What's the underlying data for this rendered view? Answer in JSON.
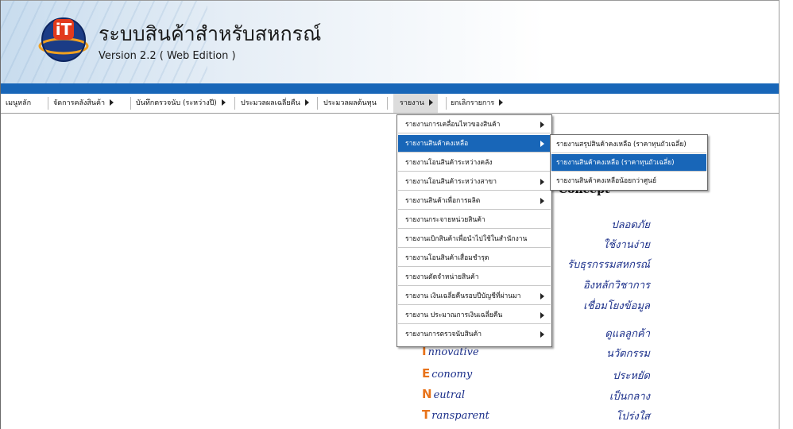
{
  "app": {
    "title": "ระบบสินค้าสำหรับสหกรณ์",
    "version": "Version 2.2 ( Web Edition )",
    "logo_text": "iT"
  },
  "colors": {
    "accent": "#1866b8",
    "highlight_text": "#ffffff",
    "value_text": "#1b2f8a",
    "initial_letter": "#e8731a"
  },
  "menubar": {
    "items": [
      {
        "label": "เมนูหลัก",
        "has_submenu": false
      },
      {
        "label": "จัดการคลังสินค้า",
        "has_submenu": true
      },
      {
        "label": "บันทึกตรวจนับ (ระหว่างปี)",
        "has_submenu": true
      },
      {
        "label": "ประมวลผลเฉลี่ยคืน",
        "has_submenu": true
      },
      {
        "label": "ประมวลผลต้นทุน",
        "has_submenu": false
      },
      {
        "label": "รายงาน",
        "has_submenu": true,
        "active": true
      },
      {
        "label": "ยกเลิกรายการ",
        "has_submenu": true
      }
    ]
  },
  "report_menu": {
    "items": [
      {
        "label": "รายงานการเคลื่อนไหวของสินค้า",
        "has_submenu": true
      },
      {
        "label": "รายงานสินค้าคงเหลือ",
        "has_submenu": true,
        "highlighted": true
      },
      {
        "label": "รายงานโอนสินค้าระหว่างคลัง",
        "has_submenu": false
      },
      {
        "label": "รายงานโอนสินค้าระหว่างสาขา",
        "has_submenu": true
      },
      {
        "label": "รายงานสินค้าเพื่อการผลิต",
        "has_submenu": true
      },
      {
        "label": "รายงานกระจายหน่วยสินค้า",
        "has_submenu": false
      },
      {
        "label": "รายงานเบิกสินค้าเพื่อนำไปใช้ในสำนักงาน",
        "has_submenu": false
      },
      {
        "label": "รายงานโอนสินค้าเสื่อมชำรุด",
        "has_submenu": false
      },
      {
        "label": "รายงานตัดจำหน่ายสินค้า",
        "has_submenu": false
      },
      {
        "label": "รายงาน เงินเฉลี่ยคืนรอบปีบัญชีที่ผ่านมา",
        "has_submenu": true
      },
      {
        "label": "รายงาน ประมาณการเงินเฉลี่ยคืน",
        "has_submenu": true
      },
      {
        "label": "รายงานการตรวจนับสินค้า",
        "has_submenu": true
      }
    ]
  },
  "stock_submenu": {
    "items": [
      {
        "label": "รายงานสรุปสินค้าคงเหลือ (ราคาทุนถัวเฉลี่ย)",
        "highlighted": false
      },
      {
        "label": "รายงานสินค้าคงเหลือ (ราคาทุนถัวเฉลี่ย)",
        "highlighted": true
      },
      {
        "label": "รายงานสินค้าคงเหลือน้อยกว่าศูนย์",
        "highlighted": false
      }
    ]
  },
  "concept": {
    "heading": "Concept",
    "values": [
      "ปลอดภัย",
      "ใช้งานง่าย",
      "รับธุรกรรมสหกรณ์",
      "อิงหลักวิชาการ",
      "เชื่อมโยงข้อมูล",
      "ดูแลลูกค้า",
      "นวัตกรรม",
      "ประหยัด",
      "เป็นกลาง",
      "โปร่งใส"
    ],
    "words": [
      {
        "initial": "I",
        "rest": "nnovative"
      },
      {
        "initial": "E",
        "rest": "conomy"
      },
      {
        "initial": "N",
        "rest": "eutral"
      },
      {
        "initial": "T",
        "rest": "ransparent"
      }
    ]
  }
}
